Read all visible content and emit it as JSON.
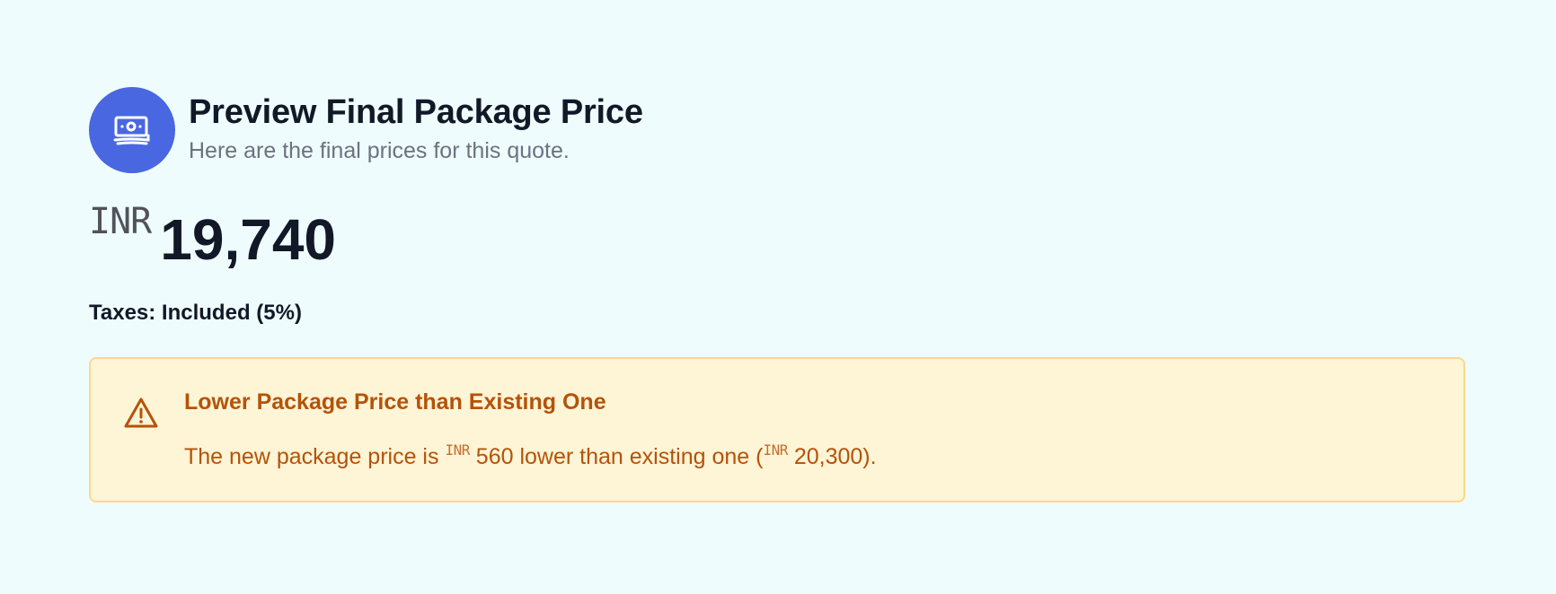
{
  "header": {
    "title": "Preview Final Package Price",
    "subtitle": "Here are the final prices for this quote.",
    "icon": "money-icon"
  },
  "price": {
    "currency": "INR",
    "amount": "19,740"
  },
  "taxes": "Taxes: Included (5%)",
  "alert": {
    "icon": "warning-icon",
    "title": "Lower Package Price than Existing One",
    "body_prefix": "The new package price is",
    "difference_currency": "INR",
    "difference_amount": "560 lower than existing one (",
    "existing_currency": "INR",
    "existing_amount": "20,300)."
  },
  "colors": {
    "background": "#effcfe",
    "accent": "#4967e0",
    "warning_text": "#b45309",
    "warning_bg": "#fef4d6",
    "warning_border": "#fbd98a"
  }
}
